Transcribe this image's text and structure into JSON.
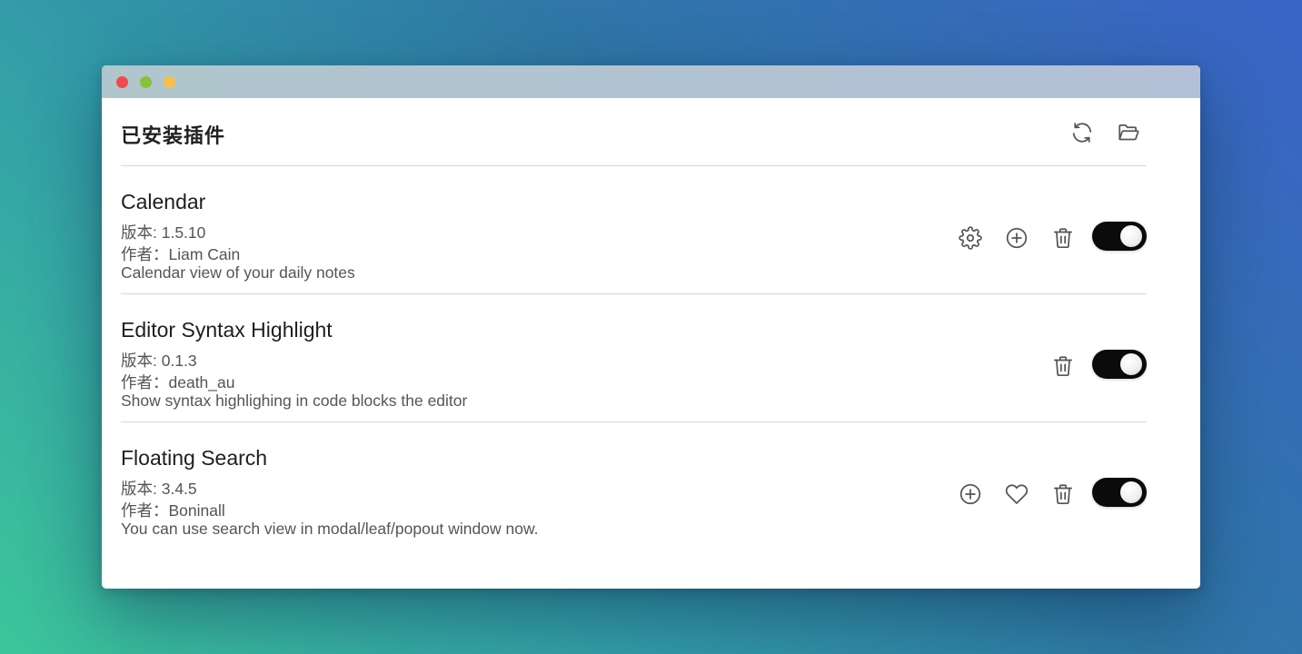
{
  "window": {
    "traffic_lights": [
      "close",
      "minimize",
      "zoom"
    ]
  },
  "header": {
    "title": "已安装插件",
    "refresh_icon": "refresh-icon",
    "folder_icon": "folder-open-icon"
  },
  "plugins": [
    {
      "name": "Calendar",
      "version": "版本: 1.5.10",
      "author": "作者：Liam Cain",
      "description": "Calendar view of your daily notes",
      "actions": [
        "gear-icon",
        "plus-circle-icon",
        "trash-icon"
      ],
      "enabled": true
    },
    {
      "name": "Editor Syntax Highlight",
      "version": "版本: 0.1.3",
      "author": "作者：death_au",
      "description": "Show syntax highlighing in code blocks the editor",
      "actions": [
        "trash-icon"
      ],
      "enabled": true
    },
    {
      "name": "Floating Search",
      "version": "版本: 3.4.5",
      "author": "作者：Boninall",
      "description": "You can use search view in modal/leaf/popout window now.",
      "actions": [
        "plus-circle-icon",
        "heart-icon",
        "trash-icon"
      ],
      "enabled": true
    }
  ],
  "colors": {
    "toggle_on": "#0b0b0b",
    "icon": "#555555",
    "title_text": "#1f1f1f",
    "meta_text": "#555555",
    "divider": "#d7d7d7"
  }
}
